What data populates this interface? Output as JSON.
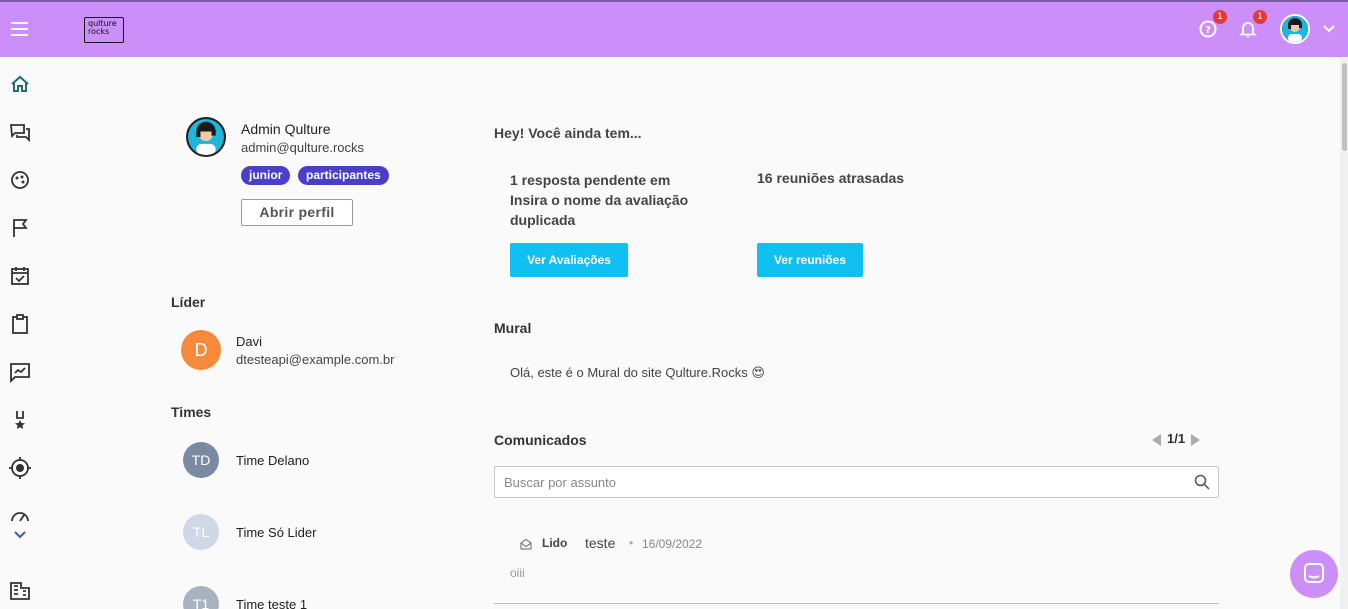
{
  "header": {
    "logo_line1": "qulture",
    "logo_line2": "rocks",
    "help_badge": "1",
    "notifications_badge": "1"
  },
  "profile": {
    "name": "Admin Qulture",
    "email": "admin@qulture.rocks",
    "tags": [
      "junior",
      "participantes"
    ],
    "open_profile_label": "Abrir perfil"
  },
  "leader": {
    "title": "Líder",
    "initial": "D",
    "name": "Davi",
    "email": "dtesteapi@example.com.br"
  },
  "teams": {
    "title": "Times",
    "items": [
      {
        "initials": "TD",
        "name": "Time Delano",
        "color": "#7a8aa0"
      },
      {
        "initials": "TL",
        "name": "Time Só Lider",
        "color": "#d0d8e6"
      },
      {
        "initials": "T1",
        "name": "Time teste 1",
        "color": "#a9b2c0"
      }
    ]
  },
  "pending": {
    "title": "Hey! Você ainda tem...",
    "evaluations_text": "1 resposta pendente em Insira o nome da avaliação duplicada",
    "evaluations_button": "Ver Avaliações",
    "meetings_text": "16 reuniões atrasadas",
    "meetings_button": "Ver reuniões"
  },
  "mural": {
    "title": "Mural",
    "text": "Olá, este é o Mural do site Qulture.Rocks 😍"
  },
  "announcements": {
    "title": "Comunicados",
    "pagination": "1/1",
    "search_placeholder": "Buscar por assunto",
    "items": [
      {
        "status": "Lido",
        "subject": "teste",
        "separator": "•",
        "date": "16/09/2022",
        "body": "oiii"
      }
    ]
  },
  "colors": {
    "topbar": "#cc8ef9",
    "primary_button": "#10c0f2",
    "tag": "#4a3fc9",
    "leader_avatar": "#f6893a"
  }
}
